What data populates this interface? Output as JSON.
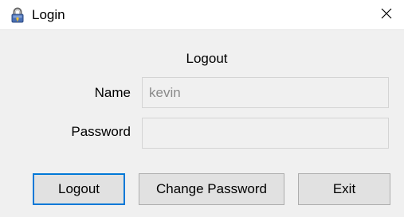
{
  "window": {
    "title": "Login",
    "close_glyph": "✕",
    "icon": "padlock-icon"
  },
  "form": {
    "heading": "Logout",
    "name_label": "Name",
    "name_value": "kevin",
    "password_label": "Password",
    "password_value": ""
  },
  "buttons": {
    "logout": "Logout",
    "change_password": "Change Password",
    "exit": "Exit"
  },
  "colors": {
    "focus_border": "#0078d7",
    "window_bg": "#f0f0f0",
    "button_bg": "#e1e1e1"
  }
}
